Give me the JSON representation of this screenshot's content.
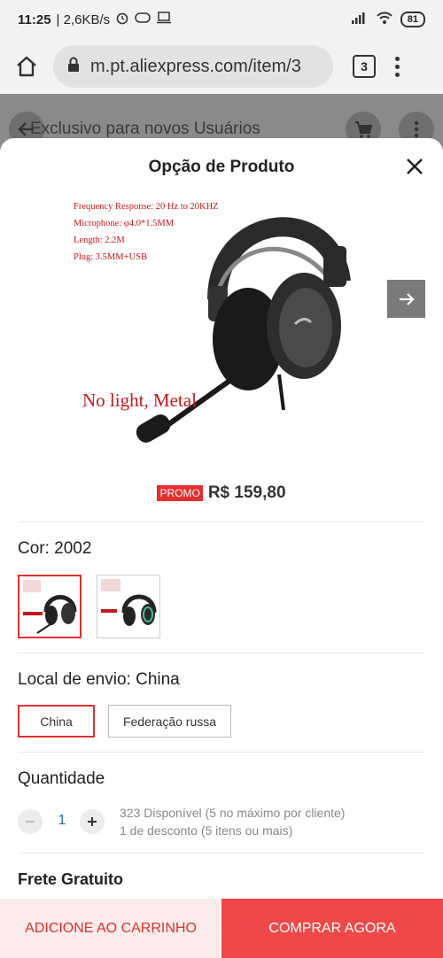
{
  "status": {
    "time": "11:25",
    "speed": "| 2,6KB/s",
    "battery": "81"
  },
  "browser": {
    "url": "m.pt.aliexpress.com/item/3",
    "tab_count": "3"
  },
  "page_behind": {
    "banner_text": "Exclusivo para novos Usuários"
  },
  "sheet": {
    "title": "Opção de Produto",
    "image": {
      "specs": [
        "Frequency Response: 20 Hz to 20KHZ",
        "Microphone: φ4.0*1.5MM",
        "Length: 2.2M",
        "Plug: 3.5MM+USB"
      ],
      "label": "No light, Metal"
    },
    "promo_badge": "PROMO",
    "price": "R$ 159,80",
    "color_label": "Cor: 2002",
    "ship_label": "Local de envio: China",
    "ship_options": [
      "China",
      "Federação russa"
    ],
    "quantity_label": "Quantidade",
    "quantity_value": "1",
    "stock_line1": "323 Disponível (5 no máximo por cliente)",
    "stock_line2": "1 de desconto (5 itens ou mais)",
    "free_shipping": "Frete Gratuito"
  },
  "footer": {
    "add_to_cart": "ADICIONE AO CARRINHO",
    "buy_now": "COMPRAR AGORA"
  },
  "colors": {
    "accent": "#e62e2e",
    "buy_button": "#f04848",
    "cart_button_bg": "#fdecec",
    "qty_value": "#1f6fbf"
  }
}
